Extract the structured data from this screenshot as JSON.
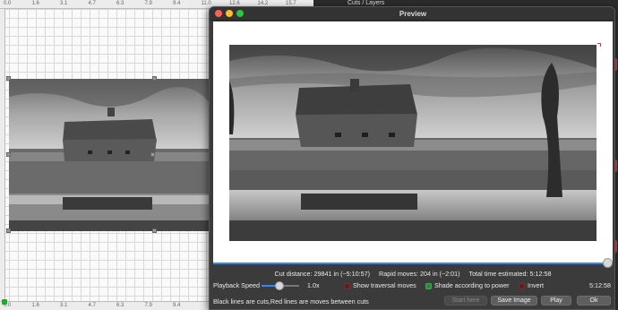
{
  "app": {
    "title": "Cuts / Layers"
  },
  "ruler": {
    "top_labels": [
      "0.0",
      "1.6",
      "3.1",
      "4.7",
      "6.3",
      "7.9",
      "9.4",
      "11.0",
      "12.6",
      "14.2",
      "15.7",
      "17.3"
    ],
    "bottom_labels": [
      "0.0",
      "1.6",
      "3.1",
      "4.7",
      "6.3",
      "7.9",
      "9.4"
    ]
  },
  "preview": {
    "title": "Preview",
    "stats": {
      "cut_distance": "Cut distance: 29841 in (~5:10:57)",
      "rapid_moves": "Rapid moves: 204 in (~2:01)",
      "total_time": "Total time estimated: 5:12:58"
    },
    "playback_label": "Playback Speed",
    "playback_speed": "1.0x",
    "playback_fraction": 0.45,
    "options": {
      "show_traversal": {
        "label": "Show traversal moves",
        "checked": false
      },
      "shade_power": {
        "label": "Shade according to power",
        "checked": true
      },
      "invert": {
        "label": "Invert",
        "checked": false
      }
    },
    "elapsed_time": "5:12:58",
    "note": "Black lines are cuts,Red lines are moves between cuts",
    "buttons": {
      "start_here": "Start here",
      "save_image": "Save Image",
      "play": "Play",
      "ok": "Ok"
    }
  },
  "colors": {
    "accent": "#3a82f7",
    "close": "#fe5f57",
    "minimize": "#febc2e",
    "zoom": "#28c840"
  }
}
